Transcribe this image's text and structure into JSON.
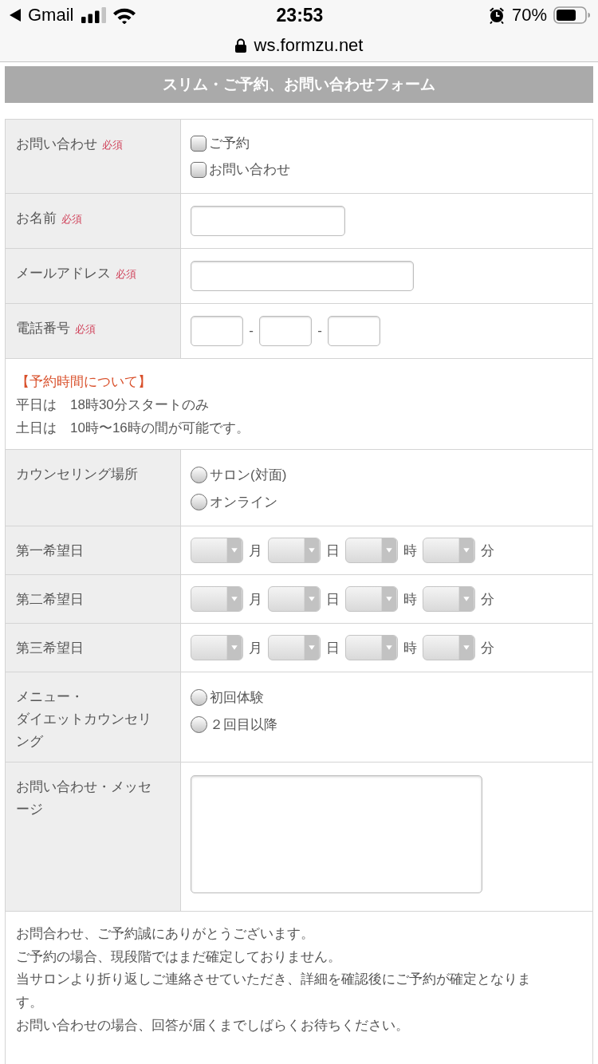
{
  "status_bar": {
    "back_app": "Gmail",
    "time": "23:53",
    "battery": "70%"
  },
  "address_bar": {
    "url": "ws.formzu.net",
    "secure": true
  },
  "form": {
    "title": "スリム・ご予約、お問い合わせフォーム",
    "rows": [
      {
        "kind": "checkboxes",
        "label": "お問い合わせ",
        "required": "必須",
        "options": [
          {
            "label": "ご予約",
            "checked": false
          },
          {
            "label": "お問い合わせ",
            "checked": false
          }
        ]
      },
      {
        "kind": "text",
        "label": "お名前",
        "required": "必須"
      },
      {
        "kind": "email",
        "label": "メールアドレス",
        "required": "必須"
      },
      {
        "kind": "phone",
        "label": "電話番号",
        "required": "必須",
        "separators": [
          "-",
          "-"
        ]
      },
      {
        "kind": "notice",
        "heading": "【予約時間について】",
        "lines": [
          "平日は　18時30分スタートのみ",
          "土日は　10時〜16時の間が可能です。"
        ]
      },
      {
        "kind": "radios",
        "label": "カウンセリング場所",
        "options": [
          {
            "label": "サロン(対面)",
            "selected": false
          },
          {
            "label": "オンライン",
            "selected": false
          }
        ]
      },
      {
        "kind": "date",
        "label": "第一希望日",
        "units": [
          "月",
          "日",
          "時",
          "分"
        ]
      },
      {
        "kind": "date",
        "label": "第二希望日",
        "units": [
          "月",
          "日",
          "時",
          "分"
        ]
      },
      {
        "kind": "date",
        "label": "第三希望日",
        "units": [
          "月",
          "日",
          "時",
          "分"
        ]
      },
      {
        "kind": "radios",
        "label_lines": [
          "メニュー・",
          "ダイエットカウンセリング"
        ],
        "options": [
          {
            "label": "初回体験",
            "selected": false
          },
          {
            "label": "２回目以降",
            "selected": false
          }
        ]
      },
      {
        "kind": "textarea",
        "label": "お問い合わせ・メッセージ"
      },
      {
        "kind": "message",
        "lines": [
          "お問合わせ、ご予約誠にありがとうございます。",
          "ご予約の場合、現段階ではまだ確定しておりません。",
          "当サロンより折り返しご連絡させていただき、詳細を確認後にご予約が確定となります。",
          "お問い合わせの場合、回答が届くまでしばらくお待ちください。"
        ]
      }
    ]
  }
}
